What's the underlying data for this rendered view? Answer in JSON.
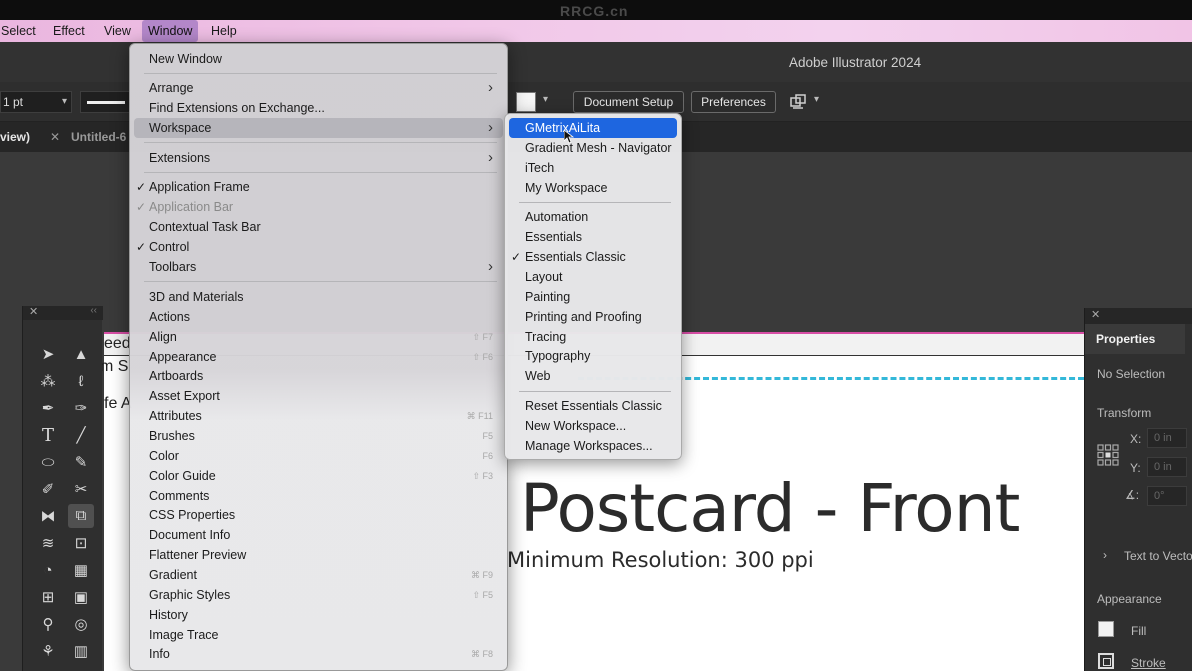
{
  "watermark": "RRCG.cn",
  "menubar": {
    "items": [
      "Select",
      "Effect",
      "View",
      "Window",
      "Help"
    ],
    "active": "Window"
  },
  "app": {
    "title": "Adobe Illustrator 2024"
  },
  "controlbar": {
    "stroke_weight": "1 pt",
    "document_setup_label": "Document Setup",
    "preferences_label": "Preferences"
  },
  "tabs": {
    "tab1": "view)",
    "tab2": "Untitled-6"
  },
  "artboard": {
    "fragments": [
      "eed",
      "m S",
      "fe A"
    ],
    "title": "Postcard - Front",
    "subtitle": "Minimum Resolution: 300 ppi"
  },
  "properties": {
    "tab": "Properties",
    "no_selection": "No Selection",
    "transform": "Transform",
    "x_label": "X:",
    "y_label": "Y:",
    "x_value": "0 in",
    "y_value": "0 in",
    "angle_value": "0°",
    "text_to_vector": "Text to Vecto",
    "appearance": "Appearance",
    "fill": "Fill",
    "stroke": "Stroke"
  },
  "window_menu": {
    "items": [
      {
        "label": "New Window"
      },
      {
        "label": "Arrange",
        "submenu": true
      },
      {
        "label": "Find Extensions on Exchange..."
      },
      {
        "label": "Workspace",
        "submenu": true,
        "highlighted": true
      },
      {
        "label": "Extensions",
        "submenu": true
      },
      {
        "label": "Application Frame",
        "checked": true
      },
      {
        "label": "Application Bar",
        "checked": true,
        "disabled": true
      },
      {
        "label": "Contextual Task Bar"
      },
      {
        "label": "Control",
        "checked": true
      },
      {
        "label": "Toolbars",
        "submenu": true
      },
      {
        "label": "3D and Materials"
      },
      {
        "label": "Actions"
      },
      {
        "label": "Align",
        "shortcut": "⇧ F7"
      },
      {
        "label": "Appearance",
        "shortcut": "⇧ F6"
      },
      {
        "label": "Artboards"
      },
      {
        "label": "Asset Export"
      },
      {
        "label": "Attributes",
        "shortcut": "⌘ F11"
      },
      {
        "label": "Brushes",
        "shortcut": "F5"
      },
      {
        "label": "Color",
        "shortcut": "F6"
      },
      {
        "label": "Color Guide",
        "shortcut": "⇧ F3"
      },
      {
        "label": "Comments"
      },
      {
        "label": "CSS Properties"
      },
      {
        "label": "Document Info"
      },
      {
        "label": "Flattener Preview"
      },
      {
        "label": "Gradient",
        "shortcut": "⌘ F9"
      },
      {
        "label": "Graphic Styles",
        "shortcut": "⇧ F5"
      },
      {
        "label": "History"
      },
      {
        "label": "Image Trace"
      },
      {
        "label": "Info",
        "shortcut": "⌘ F8"
      }
    ]
  },
  "workspace_menu": {
    "items": [
      {
        "label": "GMetrixAiLita",
        "selected": true
      },
      {
        "label": "Gradient Mesh - Navigator"
      },
      {
        "label": "iTech"
      },
      {
        "label": "My Workspace"
      },
      {
        "label": "Automation"
      },
      {
        "label": "Essentials"
      },
      {
        "label": "Essentials Classic",
        "checked": true
      },
      {
        "label": "Layout"
      },
      {
        "label": "Painting"
      },
      {
        "label": "Printing and Proofing"
      },
      {
        "label": "Tracing"
      },
      {
        "label": "Typography"
      },
      {
        "label": "Web"
      },
      {
        "label": "Reset Essentials Classic"
      },
      {
        "label": "New Workspace..."
      },
      {
        "label": "Manage Workspaces..."
      }
    ]
  },
  "tools": [
    "selection-tool",
    "direct-selection-tool",
    "magic-wand-tool",
    "lasso-tool",
    "pen-tool",
    "curvature-tool",
    "type-tool",
    "line-tool",
    "ellipse-tool",
    "shaper-tool",
    "pencil-tool",
    "scissors-tool",
    "reflect-tool",
    "scale-tool",
    "warp-tool",
    "free-transform-tool",
    "shape-builder-tool",
    "perspective-tool",
    "mesh-tool",
    "gradient-tool",
    "eyedropper-tool",
    "blend-tool",
    "symbol-sprayer-tool",
    "column-graph-tool"
  ]
}
